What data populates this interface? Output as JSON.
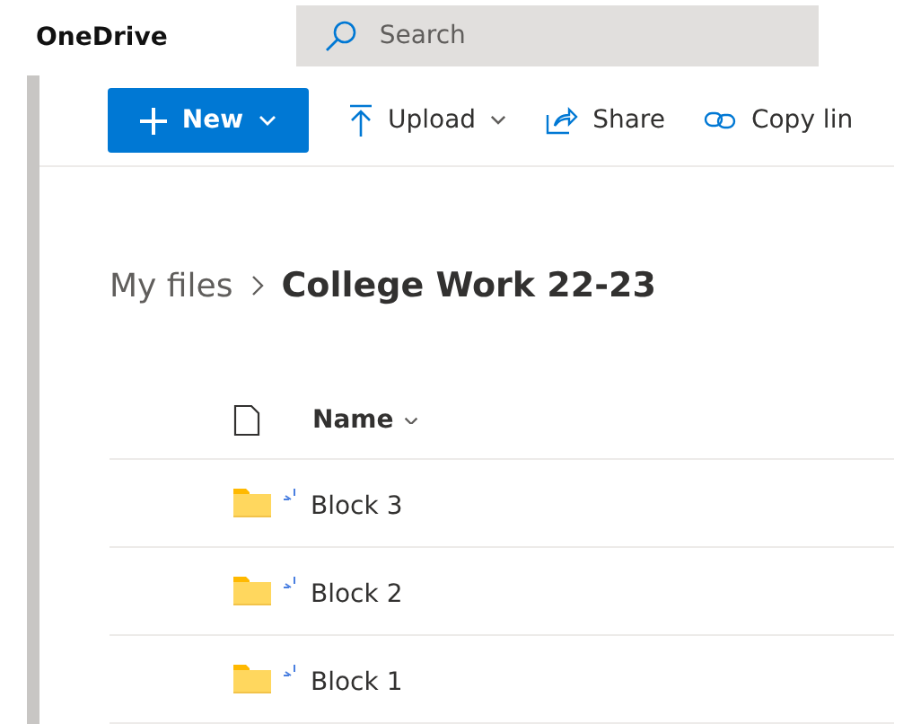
{
  "app": {
    "title": "OneDrive"
  },
  "search": {
    "placeholder": "Search"
  },
  "toolbar": [
    {
      "kind": "primary",
      "label": "New"
    },
    {
      "kind": "upload",
      "label": "Upload"
    },
    {
      "kind": "share",
      "label": "Share"
    },
    {
      "kind": "link",
      "label": "Copy lin"
    }
  ],
  "breadcrumb": [
    {
      "label": "My files",
      "current": false
    },
    {
      "label": "College Work 22-23",
      "current": true
    }
  ],
  "table": {
    "columns": [
      {
        "label": "Name"
      }
    ],
    "rows": [
      {
        "name": "Block 3",
        "new": true
      },
      {
        "name": "Block 2",
        "new": true
      },
      {
        "name": "Block 1",
        "new": true
      }
    ]
  }
}
